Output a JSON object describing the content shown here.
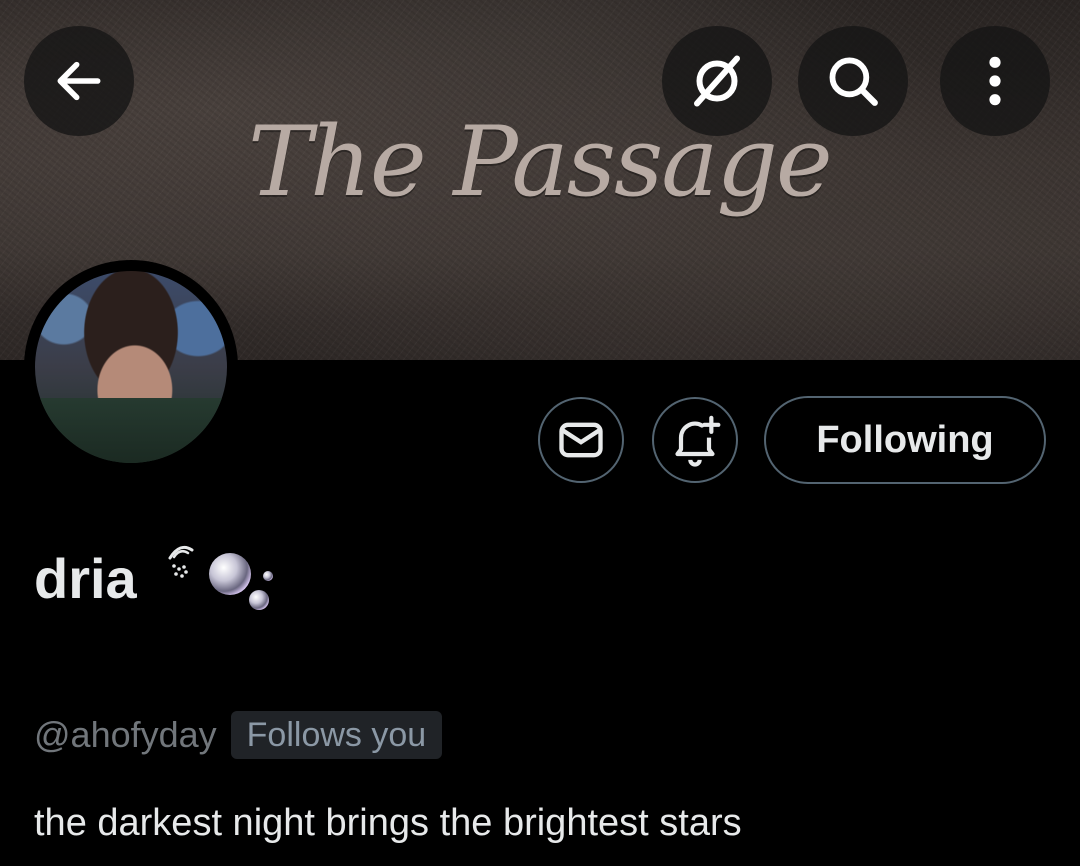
{
  "header": {
    "banner_title": "The Passage",
    "back_label": "Back",
    "grok_label": "Grok",
    "search_label": "Search",
    "more_label": "More options",
    "icons": {
      "back": "arrow-left-icon",
      "grok": "grok-slash-circle-icon",
      "search": "search-icon",
      "more": "vertical-dots-icon"
    }
  },
  "profile": {
    "display_name": "dria",
    "name_emojis": [
      "telephone-receiver-emoji",
      "bubbles-emoji"
    ],
    "handle": "@ahofyday",
    "follows_you_badge": "Follows you",
    "bio": "the darkest night brings the brightest stars"
  },
  "actions": {
    "message_icon": "envelope-icon",
    "notify_icon": "bell-plus-icon",
    "following_label": "Following"
  },
  "colors": {
    "background": "#000000",
    "text_primary": "#e7e9ea",
    "text_secondary": "#71767b",
    "border": "#536471",
    "badge_bg": "#202327"
  }
}
